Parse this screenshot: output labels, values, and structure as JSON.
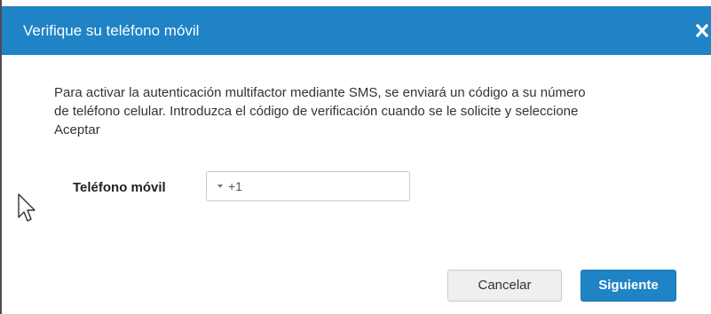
{
  "dialog": {
    "title": "Verifique su teléfono móvil",
    "close_label": "×",
    "body_lines": [
      "Para activar la autenticación multifactor mediante SMS, se enviará un código a su número",
      "de teléfono celular. Introduzca el código de verificación cuando se le solicite y seleccione",
      "Aceptar"
    ]
  },
  "form": {
    "phone_label": "Teléfono móvil",
    "country_code": "+1"
  },
  "buttons": {
    "cancel_label": "Cancelar",
    "next_label": "Siguiente"
  },
  "colors": {
    "header": "#1f83c6",
    "primary_button": "#1f83c6",
    "secondary_button": "#efefef"
  },
  "icons": {
    "close": "close-icon",
    "dropdown": "caret-down-icon",
    "cursor": "mouse-pointer-icon"
  }
}
